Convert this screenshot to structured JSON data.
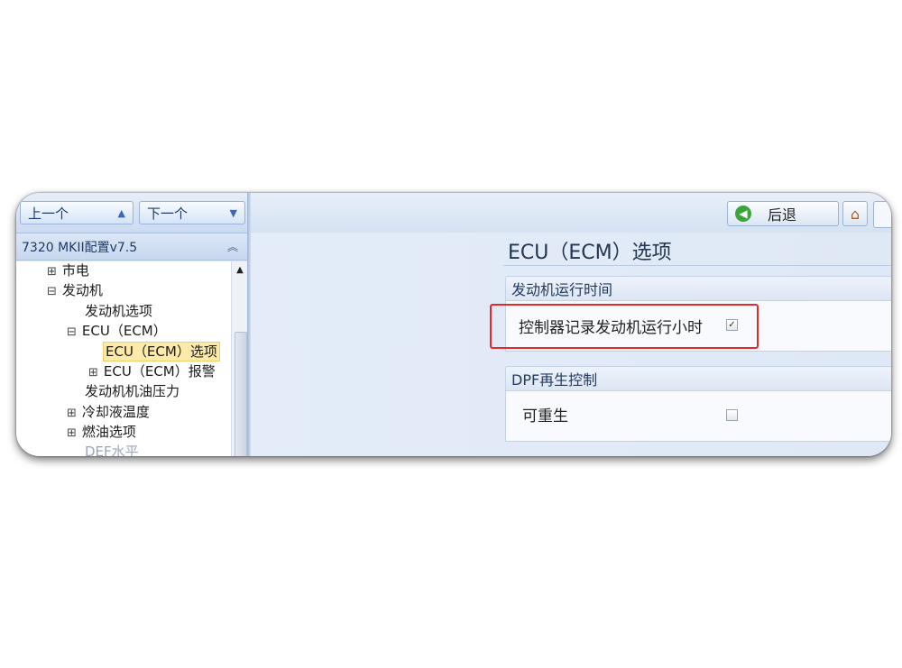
{
  "nav": {
    "prev_label": "上一个",
    "next_label": "下一个",
    "config_title": "7320 MKII配置v7.5",
    "tree": [
      {
        "expander": "⊞",
        "label": "市电"
      },
      {
        "expander": "⊟",
        "label": "发动机"
      },
      {
        "expander": "",
        "label": "发动机选项"
      },
      {
        "expander": "⊟",
        "label": "ECU（ECM）"
      },
      {
        "expander": "",
        "label": "ECU（ECM）选项",
        "selected": true
      },
      {
        "expander": "⊞",
        "label": "ECU（ECM）报警"
      },
      {
        "expander": "",
        "label": "发动机机油压力"
      },
      {
        "expander": "⊞",
        "label": "冷却液温度"
      },
      {
        "expander": "⊞",
        "label": "燃油选项"
      },
      {
        "expander": "",
        "label": "DEF水平"
      }
    ]
  },
  "toolbar": {
    "back_label": "后退"
  },
  "content": {
    "page_title": "ECU（ECM）选项",
    "groups": [
      {
        "header": "发动机运行时间",
        "option_label": "控制器记录发动机运行小时",
        "checked": true
      },
      {
        "header": "DPF再生控制",
        "option_label": "可重生",
        "checked": false
      }
    ]
  },
  "colors": {
    "highlight_border": "#e12b2b",
    "selected_bg": "#fde9a8",
    "back_icon": "#3aa63a"
  }
}
